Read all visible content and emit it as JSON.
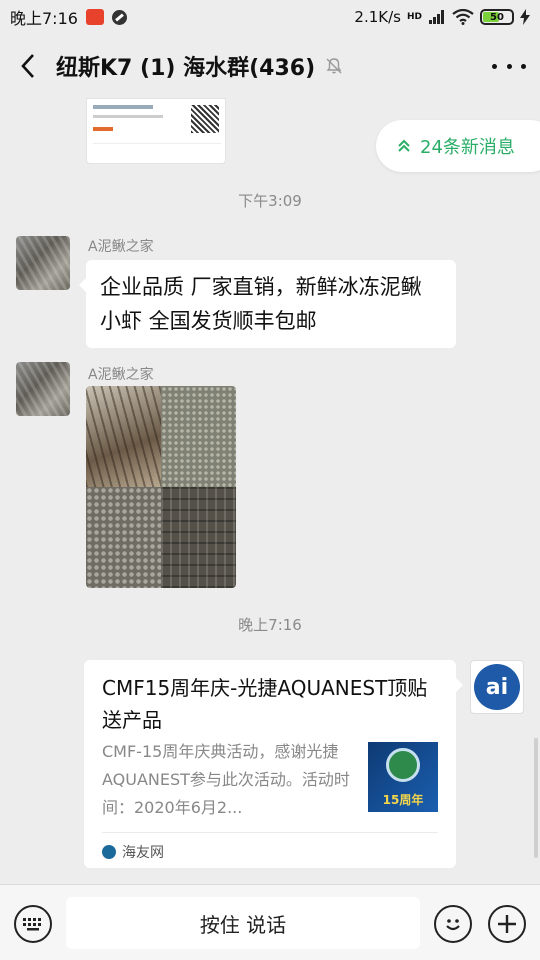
{
  "status_bar": {
    "time": "晚上7:16",
    "speed": "2.1K/s",
    "network": "HD",
    "battery": "50"
  },
  "header": {
    "title": "纽斯K7 (1) 海水群(436)"
  },
  "new_messages": {
    "label": "24条新消息"
  },
  "messages": [
    {
      "type": "time",
      "text": "下午3:09"
    },
    {
      "type": "text",
      "sender": "A泥鳅之家",
      "lines": [
        "企业品质 厂家直销，新鲜冰冻泥鳅",
        "小虾 全国发货顺丰包邮"
      ]
    },
    {
      "type": "image",
      "sender": "A泥鳅之家"
    },
    {
      "type": "time",
      "text": "晚上7:16"
    },
    {
      "type": "link",
      "title": "CMF15周年庆-光捷AQUANEST顶贴送产品",
      "desc": "CMF-15周年庆典活动，感谢光捷AQUANEST参与此次活动。活动时间：2020年6月2...",
      "thumb_text": "15周年",
      "source": "海友网"
    }
  ],
  "input_bar": {
    "hold_talk": "按住 说话"
  },
  "colors": {
    "accent_green": "#2aae67",
    "background": "#ededed"
  },
  "icons": [
    "back-icon",
    "mute-icon",
    "more-icon",
    "keyboard-icon",
    "emoji-icon",
    "plus-icon"
  ]
}
